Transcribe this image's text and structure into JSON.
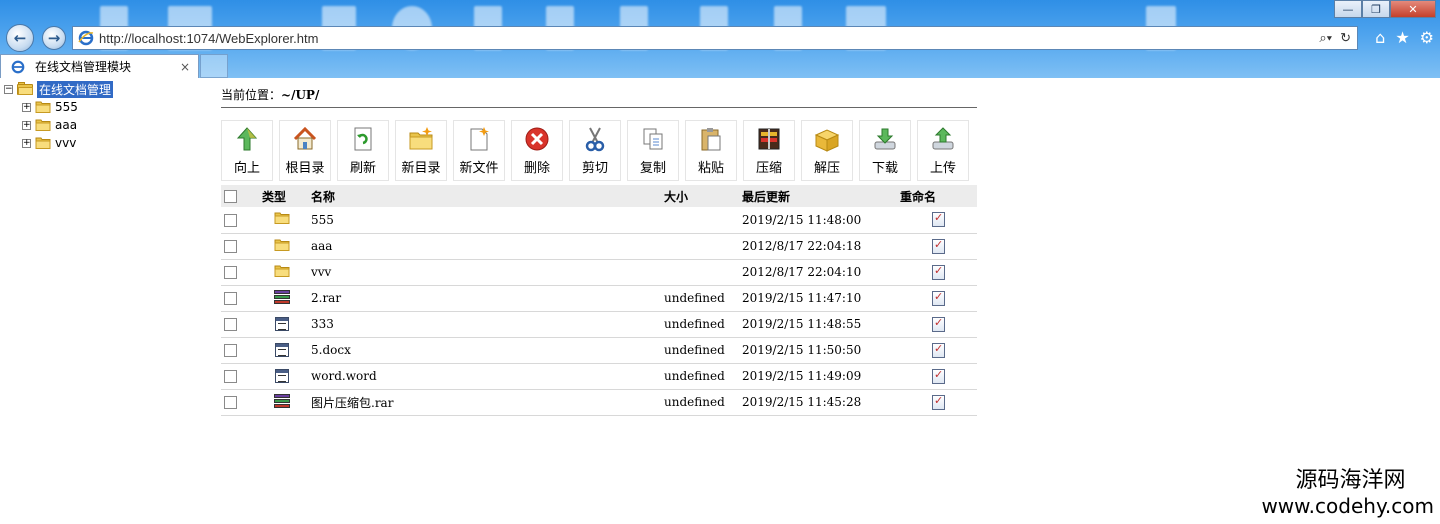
{
  "browser": {
    "url": "http://localhost:1074/WebExplorer.htm",
    "tab_title": "在线文档管理模块",
    "tab_close": "×",
    "window_controls": {
      "minimize": "—",
      "restore": "❐",
      "close": "✕"
    }
  },
  "tree": {
    "root": {
      "label": "在线文档管理",
      "expander": "−"
    },
    "items": [
      {
        "label": "555",
        "expander": "+"
      },
      {
        "label": "aaa",
        "expander": "+"
      },
      {
        "label": "vvv",
        "expander": "+"
      }
    ]
  },
  "location": {
    "label": "当前位置：",
    "path": "~/UP/"
  },
  "toolbar": [
    {
      "name": "up",
      "label": "向上",
      "icon": "up-arrow-icon"
    },
    {
      "name": "root",
      "label": "根目录",
      "icon": "home-icon"
    },
    {
      "name": "refresh",
      "label": "刷新",
      "icon": "refresh-icon"
    },
    {
      "name": "new-folder",
      "label": "新目录",
      "icon": "new-folder-icon"
    },
    {
      "name": "new-file",
      "label": "新文件",
      "icon": "new-file-icon"
    },
    {
      "name": "delete",
      "label": "删除",
      "icon": "delete-icon"
    },
    {
      "name": "cut",
      "label": "剪切",
      "icon": "scissors-icon"
    },
    {
      "name": "copy",
      "label": "复制",
      "icon": "copy-icon"
    },
    {
      "name": "paste",
      "label": "粘贴",
      "icon": "paste-icon"
    },
    {
      "name": "compress",
      "label": "压缩",
      "icon": "compress-icon"
    },
    {
      "name": "extract",
      "label": "解压",
      "icon": "extract-box-icon"
    },
    {
      "name": "download",
      "label": "下载",
      "icon": "download-icon"
    },
    {
      "name": "upload",
      "label": "上传",
      "icon": "upload-icon"
    }
  ],
  "table": {
    "headers": {
      "type": "类型",
      "name": "名称",
      "size": "大小",
      "date": "最后更新",
      "rename": "重命名"
    },
    "rows": [
      {
        "type": "folder",
        "name": "555",
        "size": "",
        "date": "2019/2/15 11:48:00"
      },
      {
        "type": "folder",
        "name": "aaa",
        "size": "",
        "date": "2012/8/17 22:04:18"
      },
      {
        "type": "folder",
        "name": "vvv",
        "size": "",
        "date": "2012/8/17 22:04:10"
      },
      {
        "type": "rar",
        "name": "2.rar",
        "size": "undefined",
        "date": "2019/2/15 11:47:10"
      },
      {
        "type": "file",
        "name": "333",
        "size": "undefined",
        "date": "2019/2/15 11:48:55"
      },
      {
        "type": "file",
        "name": "5.docx",
        "size": "undefined",
        "date": "2019/2/15 11:50:50"
      },
      {
        "type": "file",
        "name": "word.word",
        "size": "undefined",
        "date": "2019/2/15 11:49:09"
      },
      {
        "type": "rar",
        "name": "图片压缩包.rar",
        "size": "undefined",
        "date": "2019/2/15 11:45:28"
      }
    ]
  },
  "watermark": {
    "line1": "源码海洋网",
    "line2": "www.codehy.com"
  }
}
